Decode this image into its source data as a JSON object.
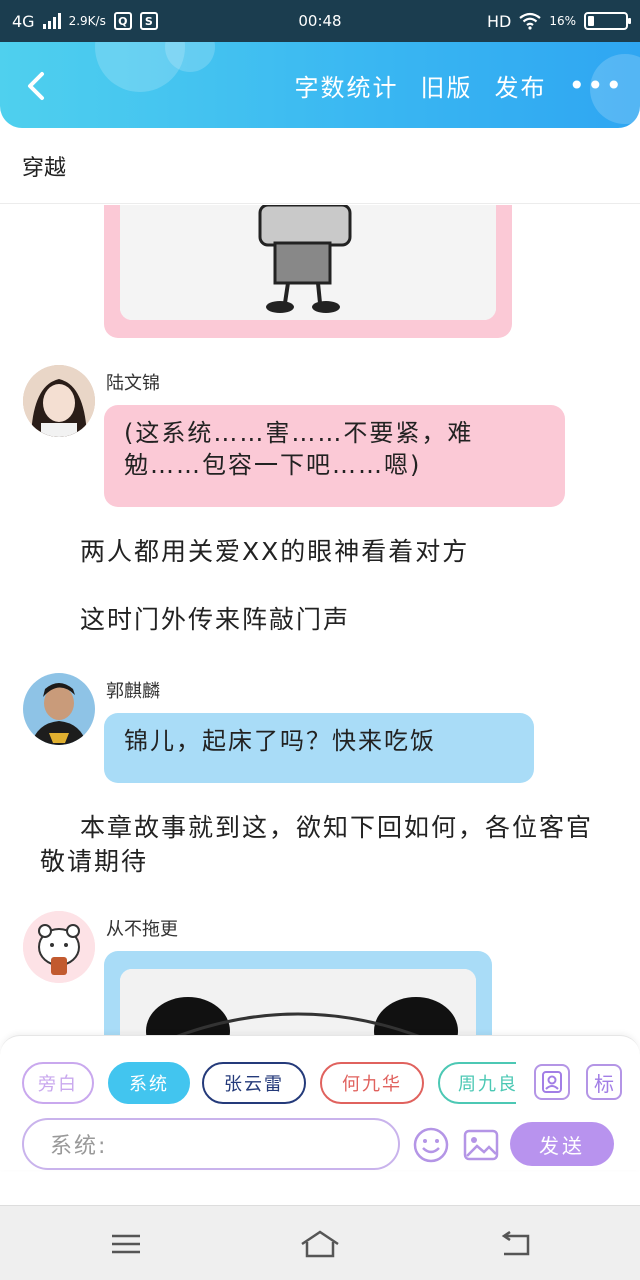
{
  "status_bar": {
    "network": "4G",
    "speed": "2.9K/s",
    "time": "00:48",
    "hd": "HD",
    "battery_text": "16%",
    "battery_level": 0.16
  },
  "header": {
    "word_count": "字数统计",
    "old_version": "旧版",
    "publish": "发布",
    "more": "•••"
  },
  "story": {
    "title": "穿越"
  },
  "messages": [
    {
      "type": "chat",
      "name": "陆文锦",
      "text": "(这系统……害……不要紧，难勉……包容一下吧……嗯)",
      "bubble_color": "#fbc9d6"
    },
    {
      "type": "narration",
      "text": "两人都用关爱XX的眼神看着对方"
    },
    {
      "type": "narration",
      "text": "这时门外传来阵敲门声"
    },
    {
      "type": "chat",
      "name": "郭麒麟",
      "text": "锦儿，起床了吗？快来吃饭",
      "bubble_color": "#a9dcf7"
    },
    {
      "type": "narration",
      "text": "本章故事就到这，欲知下回如何，各位客官敬请期待"
    },
    {
      "type": "chat",
      "name": "从不拖更",
      "bubble_color": "#a9dcf7"
    }
  ],
  "composer": {
    "roles": [
      {
        "label": "旁白",
        "color": "#c9a8ee",
        "selected": false
      },
      {
        "label": "系统",
        "color": "#42c5ef",
        "selected": true
      },
      {
        "label": "张云雷",
        "color": "#243a7a",
        "selected": false
      },
      {
        "label": "何九华",
        "color": "#e0625e",
        "selected": false
      },
      {
        "label": "周九良",
        "color": "#4cc8b4",
        "selected": false
      }
    ],
    "mark_button": "标",
    "input_placeholder": "系统:",
    "send_label": "发送"
  },
  "icons": {
    "back": "chevron-left-icon",
    "profile": "person-card-icon",
    "emoji": "smiley-icon",
    "image": "image-icon",
    "menu": "menu-icon",
    "home": "home-icon",
    "back_nav": "return-icon"
  },
  "colors": {
    "header": "#39b6f2",
    "pink_bubble": "#fbc9d6",
    "blue_bubble": "#a9dcf7",
    "accent": "#b893ee"
  }
}
